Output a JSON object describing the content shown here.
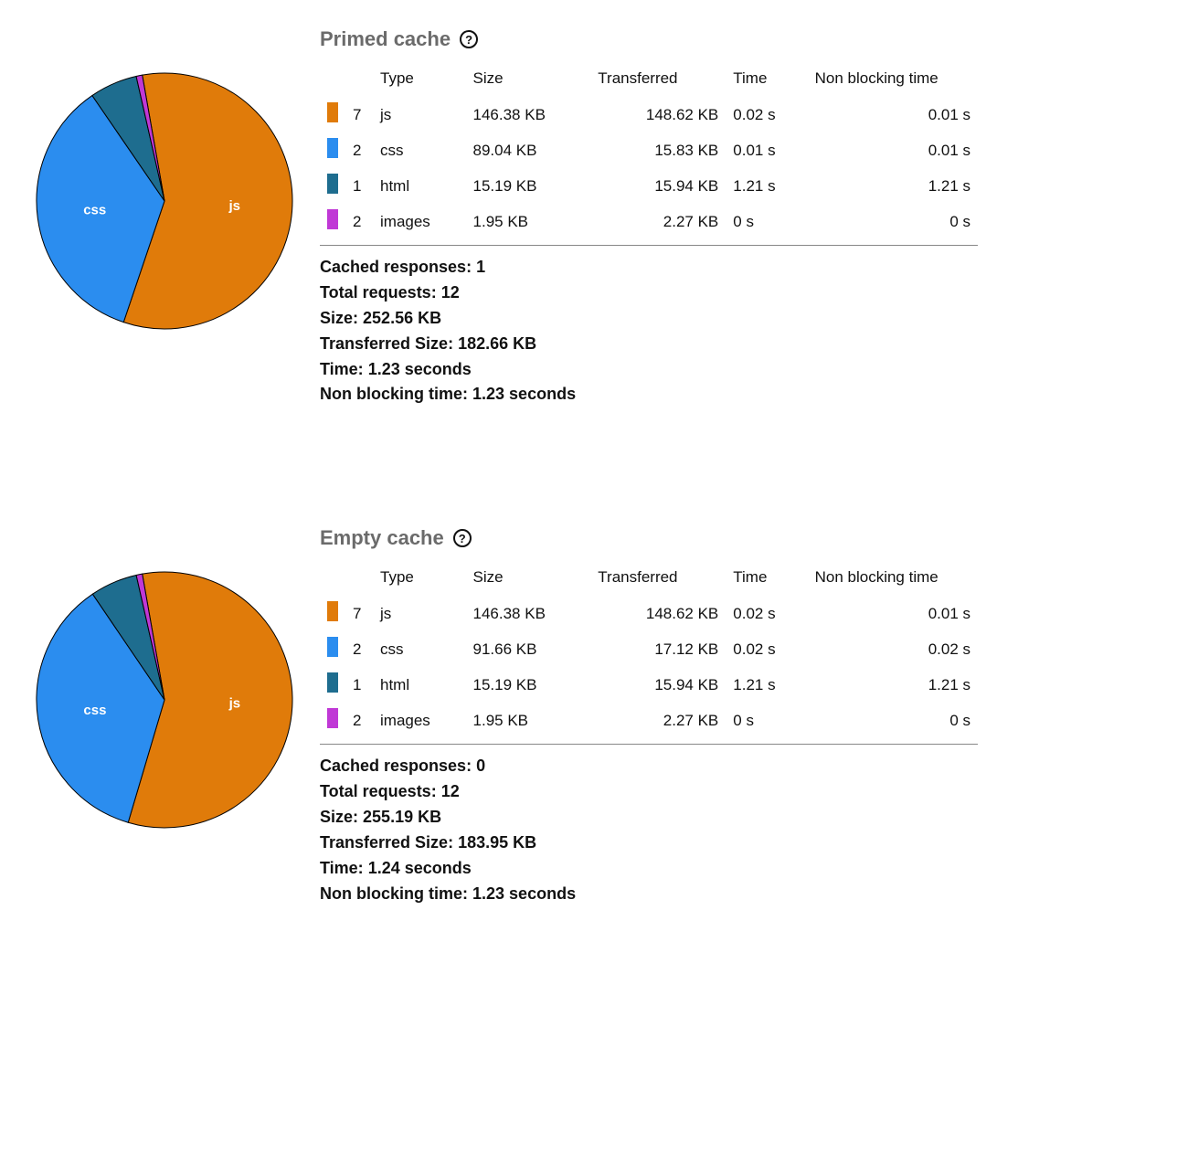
{
  "colors": {
    "js": "#e07b0a",
    "css": "#2b8def",
    "html": "#1e6d8f",
    "images": "#c038d6"
  },
  "headers": {
    "type": "Type",
    "size": "Size",
    "transferred": "Transferred",
    "time": "Time",
    "nbt": "Non blocking time"
  },
  "summary_labels": {
    "cached": "Cached responses:",
    "total": "Total requests:",
    "size": "Size:",
    "tsize": "Transferred Size:",
    "time": "Time:",
    "nbt": "Non blocking time:"
  },
  "sections": [
    {
      "title": "Primed cache",
      "rows": [
        {
          "count": "7",
          "type": "js",
          "size": "146.38 KB",
          "transferred": "148.62 KB",
          "time": "0.02 s",
          "nbt": "0.01 s",
          "color_key": "js"
        },
        {
          "count": "2",
          "type": "css",
          "size": "89.04 KB",
          "transferred": "15.83 KB",
          "time": "0.01 s",
          "nbt": "0.01 s",
          "color_key": "css"
        },
        {
          "count": "1",
          "type": "html",
          "size": "15.19 KB",
          "transferred": "15.94 KB",
          "time": "1.21 s",
          "nbt": "1.21 s",
          "color_key": "html"
        },
        {
          "count": "2",
          "type": "images",
          "size": "1.95 KB",
          "transferred": "2.27 KB",
          "time": "0 s",
          "nbt": "0 s",
          "color_key": "images"
        }
      ],
      "summary": {
        "cached": "1",
        "total": "12",
        "size": "252.56 KB",
        "tsize": "182.66 KB",
        "time": "1.23 seconds",
        "nbt": "1.23 seconds"
      }
    },
    {
      "title": "Empty cache",
      "rows": [
        {
          "count": "7",
          "type": "js",
          "size": "146.38 KB",
          "transferred": "148.62 KB",
          "time": "0.02 s",
          "nbt": "0.01 s",
          "color_key": "js"
        },
        {
          "count": "2",
          "type": "css",
          "size": "91.66 KB",
          "transferred": "17.12 KB",
          "time": "0.02 s",
          "nbt": "0.02 s",
          "color_key": "css"
        },
        {
          "count": "1",
          "type": "html",
          "size": "15.19 KB",
          "transferred": "15.94 KB",
          "time": "1.21 s",
          "nbt": "1.21 s",
          "color_key": "html"
        },
        {
          "count": "2",
          "type": "images",
          "size": "1.95 KB",
          "transferred": "2.27 KB",
          "time": "0 s",
          "nbt": "0 s",
          "color_key": "images"
        }
      ],
      "summary": {
        "cached": "0",
        "total": "12",
        "size": "255.19 KB",
        "tsize": "183.95 KB",
        "time": "1.24 seconds",
        "nbt": "1.23 seconds"
      }
    }
  ],
  "chart_data": [
    {
      "type": "pie",
      "title": "Primed cache — size by type",
      "series": [
        {
          "name": "js",
          "value": 146.38,
          "unit": "KB"
        },
        {
          "name": "css",
          "value": 89.04,
          "unit": "KB"
        },
        {
          "name": "html",
          "value": 15.19,
          "unit": "KB"
        },
        {
          "name": "images",
          "value": 1.95,
          "unit": "KB"
        }
      ],
      "labels_shown": [
        "js",
        "css"
      ]
    },
    {
      "type": "pie",
      "title": "Empty cache — size by type",
      "series": [
        {
          "name": "js",
          "value": 146.38,
          "unit": "KB"
        },
        {
          "name": "css",
          "value": 91.66,
          "unit": "KB"
        },
        {
          "name": "html",
          "value": 15.19,
          "unit": "KB"
        },
        {
          "name": "images",
          "value": 1.95,
          "unit": "KB"
        }
      ],
      "labels_shown": [
        "js",
        "css"
      ]
    }
  ]
}
